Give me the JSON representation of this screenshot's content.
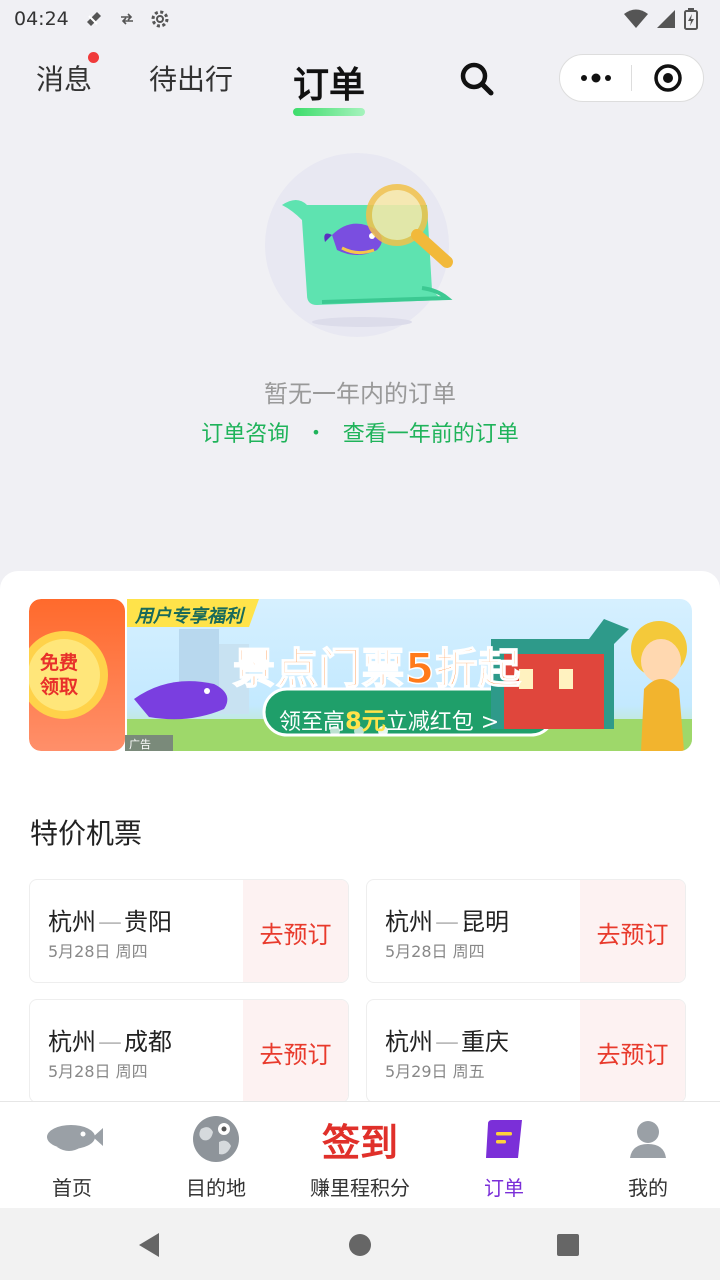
{
  "status_bar": {
    "time": "04:24"
  },
  "header": {
    "tabs": [
      {
        "label": "消息",
        "has_dot": true
      },
      {
        "label": "待出行"
      },
      {
        "label": "订单",
        "active": true
      }
    ]
  },
  "empty_state": {
    "title": "暂无一年内的订单",
    "link_consult": "订单咨询",
    "separator": "•",
    "link_older": "查看一年前的订单"
  },
  "banner": {
    "side_label": "免费领取",
    "tag": "用户专享福利",
    "headline": "景点门票5折起",
    "cta_prefix": "领至高",
    "cta_amount": "8元",
    "cta_suffix": "立减红包 >",
    "ad_label": "广告"
  },
  "flights": {
    "section_title": "特价机票",
    "items": [
      {
        "from": "杭州",
        "to": "贵阳",
        "date": "5月28日 周四",
        "action": "去预订"
      },
      {
        "from": "杭州",
        "to": "昆明",
        "date": "5月28日 周四",
        "action": "去预订"
      },
      {
        "from": "杭州",
        "to": "成都",
        "date": "5月28日 周四",
        "action": "去预订"
      },
      {
        "from": "杭州",
        "to": "重庆",
        "date": "5月29日 周五",
        "action": "去预订"
      }
    ]
  },
  "tabbar": {
    "items": [
      {
        "label": "首页",
        "icon": "blimp-icon"
      },
      {
        "label": "目的地",
        "icon": "globe-icon"
      },
      {
        "label": "赚里程积分",
        "icon": "sign-in-icon",
        "icon_text": "签到"
      },
      {
        "label": "订单",
        "icon": "order-icon",
        "active": true
      },
      {
        "label": "我的",
        "icon": "profile-icon"
      }
    ]
  },
  "colors": {
    "accent_green": "#1fb35a",
    "active_purple": "#7b2fd8",
    "book_red": "#e83a2c"
  }
}
